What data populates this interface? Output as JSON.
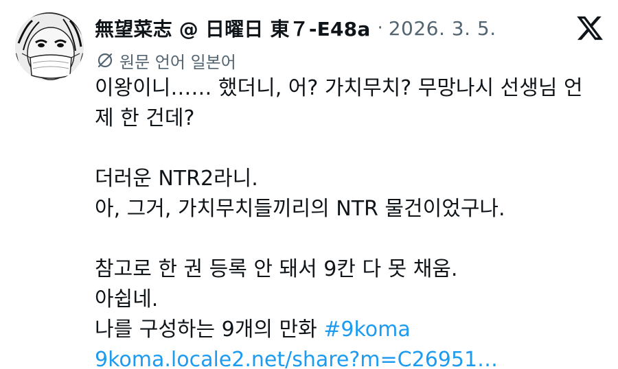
{
  "author": {
    "display_name": "無望菜志 @ 日曜日 東７-E48a",
    "avatar_icon": "manga-character-avatar-icon"
  },
  "separator": "·",
  "timestamp": "2026. 3. 5.",
  "platform_icon": "x-logo-icon",
  "translation": {
    "icon": "translate-icon",
    "label": "원문 언어 일본어"
  },
  "body": {
    "line1": "이왕이니…… 했더니, 어? 가치무치? 무망나시 선생님 언",
    "line2": "제 한 건데?",
    "line3": "더러운 NTR2라니.",
    "line4": "아, 그거, 가치무치들끼리의 NTR 물건이었구나.",
    "line5": "참고로 한 권 등록 안 돼서 9칸 다 못 채움.",
    "line6": "아쉽네.",
    "line7_text": "나를 구성하는 9개의 만화 ",
    "hashtag": "#9koma",
    "url": "9koma.locale2.net/share?m=C26951…"
  },
  "colors": {
    "text": "#0f1419",
    "secondary": "#536471",
    "link": "#1d9bf0"
  }
}
